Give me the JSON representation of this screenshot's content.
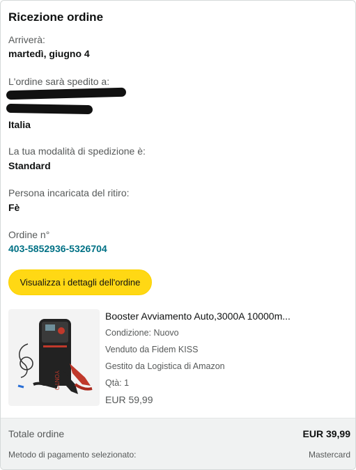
{
  "title": "Ricezione ordine",
  "arrival": {
    "label": "Arriverà:",
    "value": "martedì, giugno 4"
  },
  "shipping": {
    "label": "L'ordine sarà spedito a:",
    "country": "Italia"
  },
  "mode": {
    "label": "La tua modalità di spedizione è:",
    "value": "Standard"
  },
  "pickup": {
    "label": "Persona incaricata del ritiro:",
    "value": "Fè"
  },
  "order": {
    "label": "Ordine n°",
    "number": "403-5852936-5326704"
  },
  "details_button": "Visualizza i dettagli dell'ordine",
  "product": {
    "title": "Booster Avviamento Auto,3000A 10000m...",
    "condition": "Condizione: Nuovo",
    "sold_by": "Venduto da Fidem KISS",
    "managed_by": "Gestito da Logistica di Amazon",
    "qty": "Qtà: 1",
    "price": "EUR 59,99"
  },
  "summary": {
    "total_label": "Totale ordine",
    "total_value": "EUR 39,99",
    "payment_label": "Metodo di pagamento selezionato:",
    "payment_value": "Mastercard"
  },
  "colors": {
    "button": "#ffd814",
    "link": "#007185",
    "footer_bg": "#f0f2f2"
  }
}
